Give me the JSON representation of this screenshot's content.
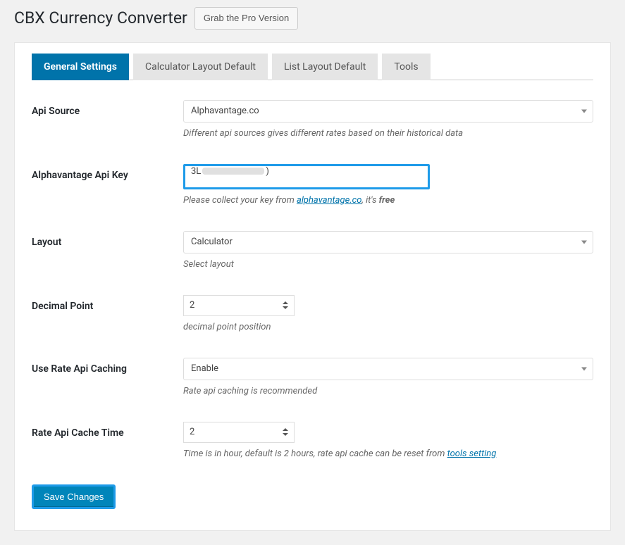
{
  "header": {
    "title": "CBX Currency Converter",
    "pro_button": "Grab the Pro Version"
  },
  "tabs": [
    {
      "label": "General Settings",
      "active": true
    },
    {
      "label": "Calculator Layout Default",
      "active": false
    },
    {
      "label": "List Layout Default",
      "active": false
    },
    {
      "label": "Tools",
      "active": false
    }
  ],
  "fields": {
    "api_source": {
      "label": "Api Source",
      "value": "Alphavantage.co",
      "help": "Different api sources gives different rates based on their historical data"
    },
    "api_key": {
      "label": "Alphavantage Api Key",
      "prefix": "3L",
      "suffix": ")",
      "help_pre": "Please collect your key from ",
      "help_link_text": "alphavantage.co",
      "help_mid": ", it's ",
      "help_strong": "free"
    },
    "layout": {
      "label": "Layout",
      "value": "Calculator",
      "help": "Select layout"
    },
    "decimal": {
      "label": "Decimal Point",
      "value": "2",
      "help": "decimal point position"
    },
    "caching": {
      "label": "Use Rate Api Caching",
      "value": "Enable",
      "help": "Rate api caching is recommended"
    },
    "cache_time": {
      "label": "Rate Api Cache Time",
      "value": "2",
      "help_pre": "Time is in hour, default is 2 hours, rate api cache can be reset from ",
      "help_link_text": "tools setting"
    }
  },
  "save_button": "Save Changes"
}
